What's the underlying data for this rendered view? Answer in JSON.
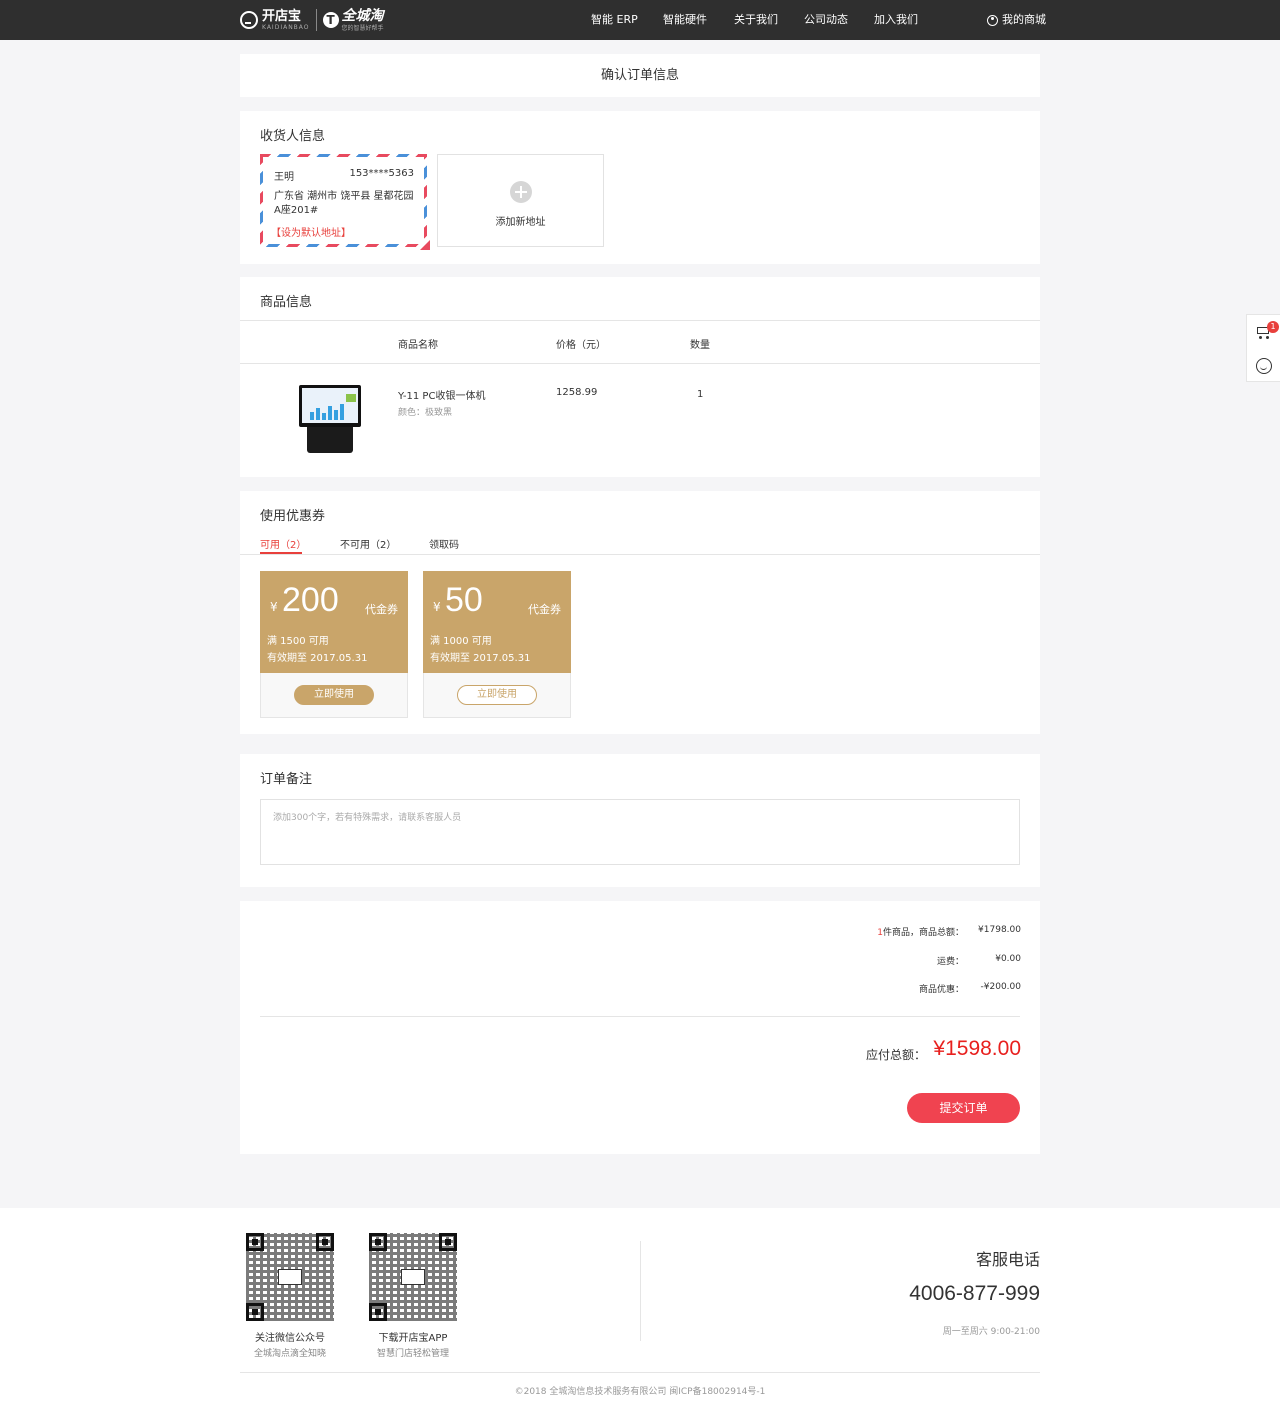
{
  "header": {
    "brand_primary": "开店宝",
    "brand_primary_sub": "KAIDIANBAO",
    "brand_secondary": "全城淘",
    "brand_secondary_sub": "您的智慧好帮手",
    "nav": [
      "智能 ERP",
      "智能硬件",
      "关于我们",
      "公司动态",
      "加入我们"
    ],
    "my_store": "我的商城"
  },
  "page_title": "确认订单信息",
  "address": {
    "section_title": "收货人信息",
    "selected": {
      "name": "王明",
      "phone": "153****5363",
      "address": "广东省 潮州市 饶平县 星都花园A座201#",
      "set_default": "【设为默认地址】"
    },
    "add_label": "添加新地址"
  },
  "goods": {
    "section_title": "商品信息",
    "columns": [
      "商品名称",
      "价格（元）",
      "数量"
    ],
    "items": [
      {
        "name": "Y-11 PC收银一体机",
        "color": "颜色：极致黑",
        "price": "1258.99",
        "qty": "1"
      }
    ]
  },
  "coupons": {
    "section_title": "使用优惠券",
    "tabs": [
      "可用（2）",
      "不可用（2）",
      "领取码"
    ],
    "active_tab": 0,
    "list": [
      {
        "currency": "¥",
        "amount": "200",
        "type": "代金券",
        "condition": "满 1500 可用",
        "valid": "有效期至 2017.05.31",
        "button": "立即使用"
      },
      {
        "currency": "¥",
        "amount": "50",
        "type": "代金券",
        "condition": "满 1000 可用",
        "valid": "有效期至 2017.05.31",
        "button": "立即使用"
      }
    ],
    "accent": "#c9a56a"
  },
  "remark": {
    "section_title": "订单备注",
    "placeholder": "添加300个字，若有特殊需求，请联系客服人员"
  },
  "summary": {
    "item_count": "1",
    "item_label": "件商品，商品总额：",
    "goods_total": "¥1798.00",
    "shipping_label": "运费：",
    "shipping": "¥0.00",
    "discount_label": "商品优惠：",
    "discount": "-¥200.00",
    "payable_label": "应付总额：",
    "payable": "¥1598.00",
    "submit": "提交订单"
  },
  "sidebar": {
    "cart_count": "1"
  },
  "footer": {
    "qr_codes": [
      {
        "caption": "关注微信公众号",
        "sub": "全城淘点滴全知晓"
      },
      {
        "caption": "下载开店宝APP",
        "sub": "智慧门店轻松管理"
      }
    ],
    "service_title": "客服电话",
    "service_phone": "4006-877-999",
    "service_hours": "周一至周六 9:00-21:00",
    "copyright": "©2018 全城淘信息技术服务有限公司 闽ICP备18002914号-1"
  },
  "colors": {
    "primary_red": "#e8403c",
    "submit_red": "#f04350",
    "header_bg": "#2f2f2f"
  }
}
